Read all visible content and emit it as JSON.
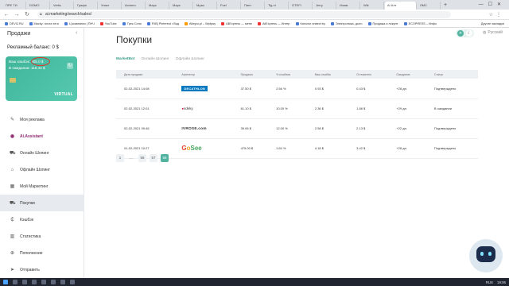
{
  "browser": {
    "tabs": [
      "ПРЕ ТИ",
      "DOMO",
      "Vertic",
      "Графи",
      "Упакт",
      "Acmero",
      "Марк",
      "Марк",
      "Музы",
      "Fuel",
      "Пинт",
      "Tig ni",
      "OTEFI",
      "Jerry",
      "Изюм",
      "Wik",
      "Ai Алт",
      "ЛМС"
    ],
    "active_tab": "Ai Алт",
    "url": "ai.marketing/search/sales/",
    "bookmarks": [
      "DEVI2.RU",
      "Macky: почта теги",
      "Ц компании | ПНЧ",
      "YouTube",
      "Трек Соня",
      "F0B] Pinterest • Вод",
      "Allegro.pl – Wpływy",
      "AliExpress — мене",
      "AliExpress — Интер",
      "Каталог инвест.by",
      "Электроника, дыто",
      "Продажа и покупе",
      "ECOPRESS – Инфо"
    ],
    "bookmarks_other": "Другие закладки"
  },
  "sidebar": {
    "title": "Продажи",
    "balance_label": "Рекламный баланс: 0 $",
    "card": {
      "cashback_line": "Ваш кэшбэк: 905.0 $",
      "pending_line": "В ожидании: 118.44 $",
      "brand": "VIRTUAL"
    },
    "items": [
      {
        "label": "Моя реклама",
        "icon": "megaphone-icon",
        "glyph": "✎"
      },
      {
        "label": "Ai.Assistant",
        "icon": "ai-assistant-icon",
        "glyph": "◉"
      },
      {
        "label": "Онлайн Шопинг",
        "icon": "cart-icon",
        "glyph": "⛟"
      },
      {
        "label": "Офлайн Шопинг",
        "icon": "store-icon",
        "glyph": "⌂"
      },
      {
        "label": "Мой Маркетинг",
        "icon": "marketing-icon",
        "glyph": "▦"
      },
      {
        "label": "Покупки",
        "icon": "purchases-icon",
        "glyph": "⛟"
      },
      {
        "label": "Кэшбэк",
        "icon": "cashback-icon",
        "glyph": "₵"
      },
      {
        "label": "Статистика",
        "icon": "chart-icon",
        "glyph": "▥"
      },
      {
        "label": "Пополнение",
        "icon": "topup-icon",
        "glyph": "⊕"
      },
      {
        "label": "Отправить",
        "icon": "send-icon",
        "glyph": "➤"
      }
    ]
  },
  "main": {
    "title": "Покупки",
    "language": "Русский",
    "subtabs": [
      "MarketBot",
      "Онлайн Шопинг",
      "Офлайн Шопинг"
    ],
    "columns": [
      "Дата продажи",
      "Агрегатор",
      "Продажа",
      "% кэшбэка",
      "Ваш кэшбэк",
      "Отложенно",
      "Ожидание",
      "Статус"
    ],
    "rows": [
      {
        "date": "02-02-2021 14:08",
        "agg": "DECATHLON",
        "sale": "37.50 $",
        "pct": "2.56 %",
        "cb": "0.93 $",
        "hold": "0.43 $",
        "wait": "+28 дн.",
        "status": "Подтверждено"
      },
      {
        "date": "02-02-2021 12:01",
        "agg": "sdeky",
        "sale": "61.10 $",
        "pct": "10.00 %",
        "cb": "2.36 $",
        "hold": "1.86 $",
        "wait": "+29 дн.",
        "status": "В ожидании"
      },
      {
        "date": "02-02-2021 09:46",
        "agg": "IVROSE.com",
        "sale": "39.06 $",
        "pct": "12.00 %",
        "cb": "2.58 $",
        "hold": "2.13 $",
        "wait": "+22 дн.",
        "status": "Подтверждено"
      },
      {
        "date": "01-02-2021 10:27",
        "agg": "GoSee",
        "sale": "475.00 $",
        "pct": "1.60 %",
        "cb": "4.18 $",
        "hold": "3.42 $",
        "wait": "+28 дн.",
        "status": "Подтверждено"
      }
    ],
    "pagination": [
      "1",
      "...",
      "56",
      "57",
      "58"
    ],
    "current_page": "58"
  },
  "taskbar": {
    "lang": "RUS",
    "time": "19:06"
  },
  "colors": {
    "accent": "#4fb3a0",
    "card": "#3fb59a",
    "ai": "#8e2a6e"
  }
}
